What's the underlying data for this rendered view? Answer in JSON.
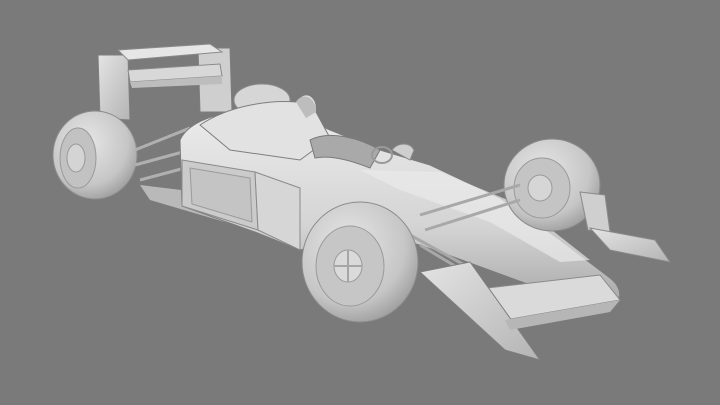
{
  "scene": {
    "subject": "f1-car-clay-render",
    "colors": {
      "background": "#7a7a7a",
      "body": "#dcdcdc",
      "body_shade": "#bdbdbd",
      "body_dark": "#8f8f8f",
      "tyre": "#d2d2d2",
      "tyre_shade": "#a9a9a9",
      "rim": "#b8b8b8",
      "outline": "#6e6e6e"
    }
  }
}
